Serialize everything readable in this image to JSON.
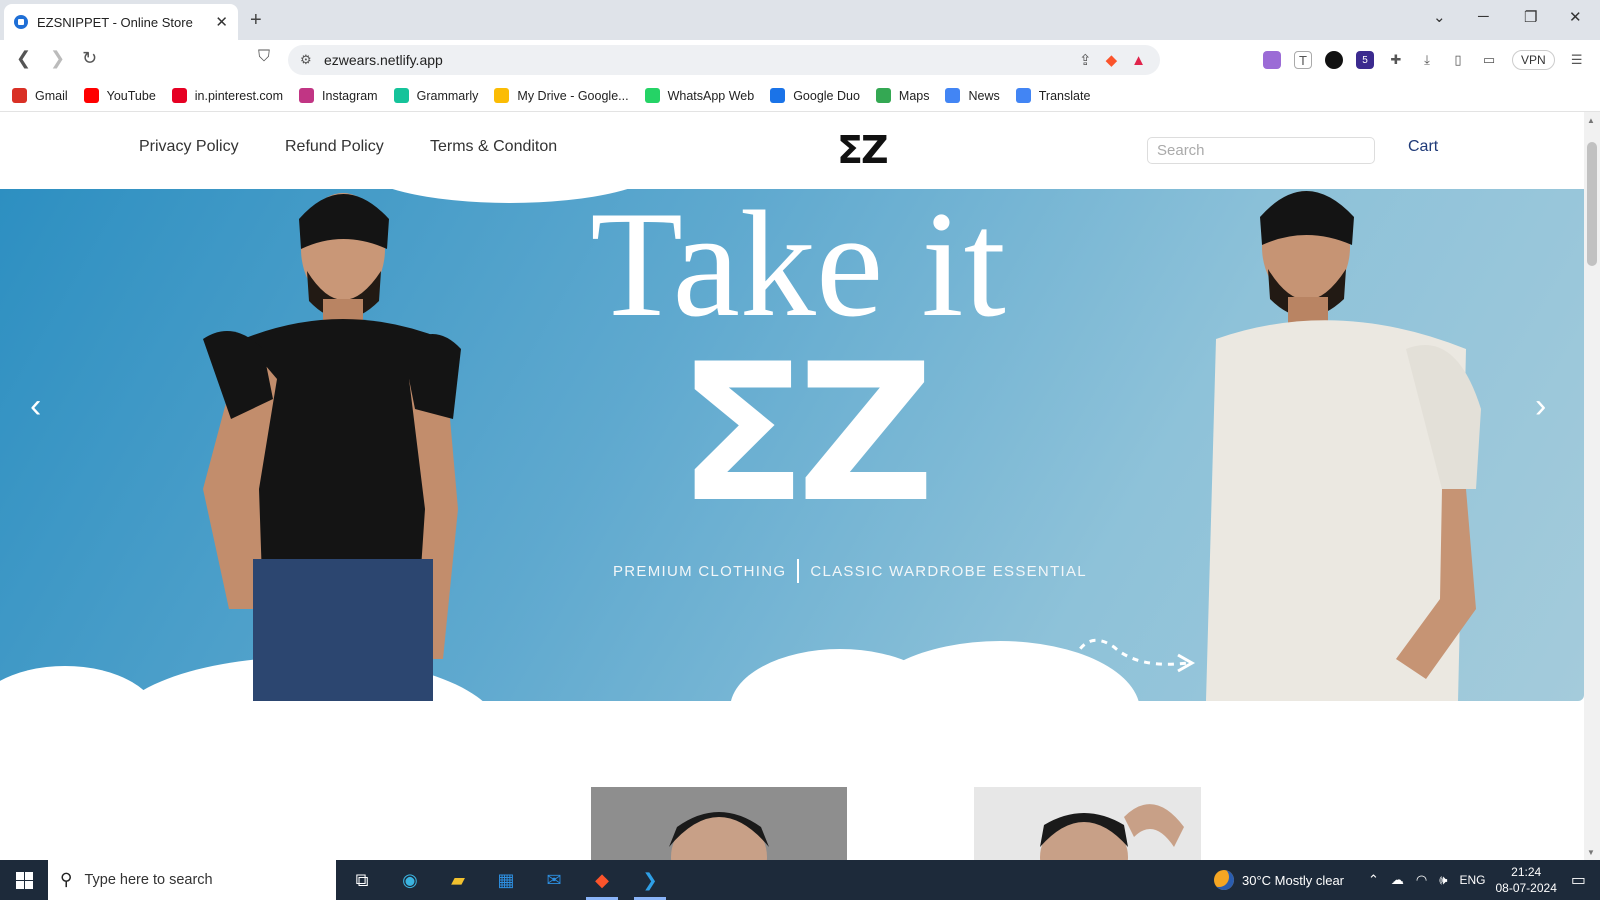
{
  "browser": {
    "tab_title": "EZSNIPPET - Online Store",
    "url": "ezwears.netlify.app",
    "vpn_label": "VPN",
    "extension_badge": "5"
  },
  "bookmarks": [
    {
      "label": "Gmail",
      "color": "#d93025"
    },
    {
      "label": "YouTube",
      "color": "#ff0000"
    },
    {
      "label": "in.pinterest.com",
      "color": "#e60023"
    },
    {
      "label": "Instagram",
      "color": "#c13584"
    },
    {
      "label": "Grammarly",
      "color": "#15c39a"
    },
    {
      "label": "My Drive - Google...",
      "color": "#fbbc04"
    },
    {
      "label": "WhatsApp Web",
      "color": "#25d366"
    },
    {
      "label": "Google Duo",
      "color": "#1a73e8"
    },
    {
      "label": "Maps",
      "color": "#34a853"
    },
    {
      "label": "News",
      "color": "#4285f4"
    },
    {
      "label": "Translate",
      "color": "#4285f4"
    }
  ],
  "site": {
    "nav": [
      "Privacy Policy",
      "Refund Policy",
      "Terms & Conditon"
    ],
    "logo": "ƩZ",
    "search_placeholder": "Search",
    "cart": "Cart"
  },
  "hero": {
    "title": "Take it",
    "logo": "ƩZ",
    "tagline_left": "PREMIUM CLOTHING",
    "tagline_right": "CLASSIC WARDROBE ESSENTIAL",
    "prev_icon": "chevron-left-icon",
    "next_icon": "chevron-right-icon"
  },
  "taskbar": {
    "search_placeholder": "Type here to search",
    "weather": "30°C  Mostly clear",
    "lang": "ENG",
    "time": "21:24",
    "date": "08-07-2024"
  },
  "colors": {
    "accent": "#1f3a78",
    "hero_gradient_start": "#2d8fc1",
    "hero_gradient_end": "#a4cbdb",
    "taskbar": "#1d2a3a"
  }
}
